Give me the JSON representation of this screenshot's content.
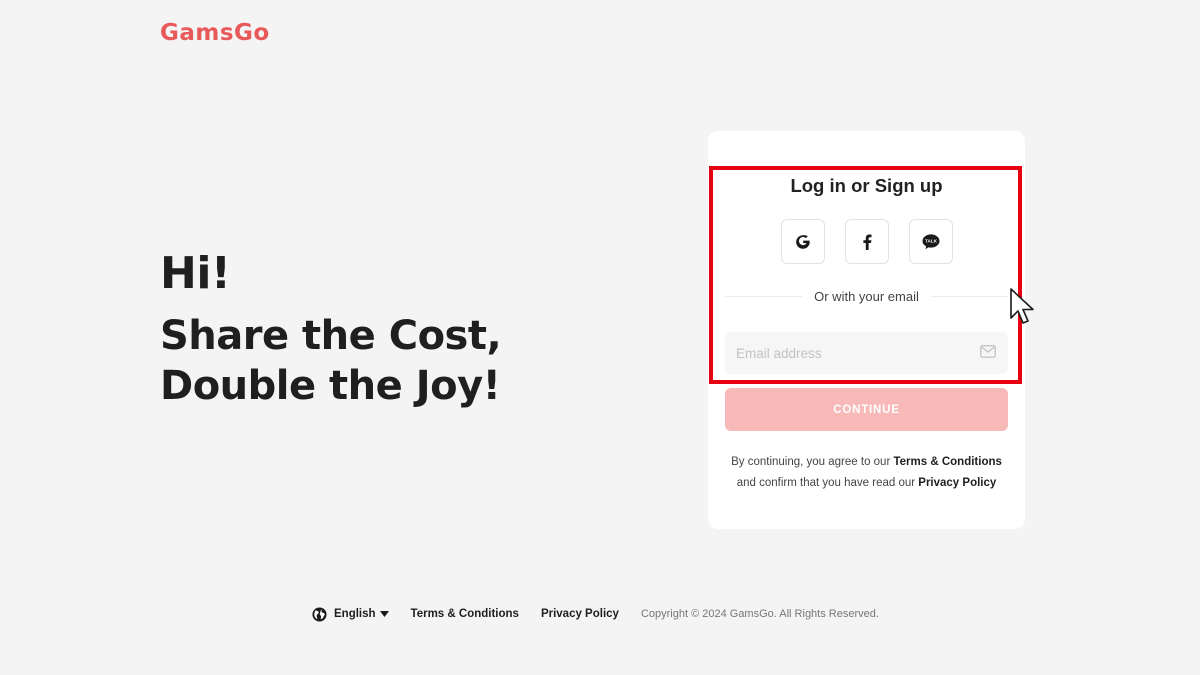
{
  "brand": {
    "logo_text": "GamsGo",
    "color": "#e8595a"
  },
  "hero": {
    "greeting": "Hi!",
    "tagline_line1": "Share the Cost,",
    "tagline_line2": "Double the Joy!"
  },
  "auth_card": {
    "title": "Log in or Sign up",
    "social": [
      {
        "name": "google",
        "icon": "google-icon"
      },
      {
        "name": "facebook",
        "icon": "facebook-icon"
      },
      {
        "name": "kakao",
        "icon": "kakaotalk-icon",
        "icon_text": "TALK"
      }
    ],
    "divider_text": "Or with your email",
    "email": {
      "placeholder": "Email address",
      "value": "",
      "icon": "mail-icon"
    },
    "continue_label": "CONTINUE",
    "continue_color": "#f8b9b9",
    "legal": {
      "prefix": "By continuing, you agree to our ",
      "terms_link": "Terms & Conditions",
      "middle": "and confirm that you have read our ",
      "privacy_link": "Privacy Policy"
    },
    "highlight_color": "#e60012"
  },
  "footer": {
    "language": "English",
    "terms": "Terms & Conditions",
    "privacy": "Privacy Policy",
    "copyright": "Copyright © 2024 GamsGo. All Rights Reserved."
  }
}
